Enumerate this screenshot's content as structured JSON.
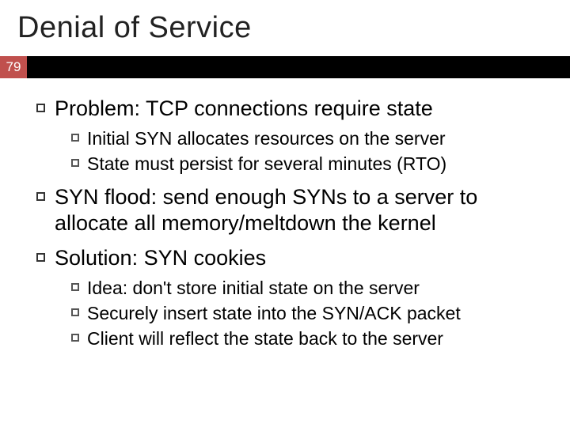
{
  "title": "Denial of Service",
  "slide_number": "79",
  "bullets": [
    {
      "text": "Problem: TCP connections require state",
      "sub": [
        "Initial SYN allocates resources on the server",
        "State must persist for several minutes (RTO)"
      ]
    },
    {
      "text": "SYN flood: send enough SYNs to a server to allocate all memory/meltdown the kernel",
      "sub": []
    },
    {
      "text": "Solution: SYN cookies",
      "sub": [
        "Idea: don't store initial state on the server",
        "Securely insert state into the SYN/ACK packet",
        "Client will reflect the state back to the server"
      ]
    }
  ]
}
